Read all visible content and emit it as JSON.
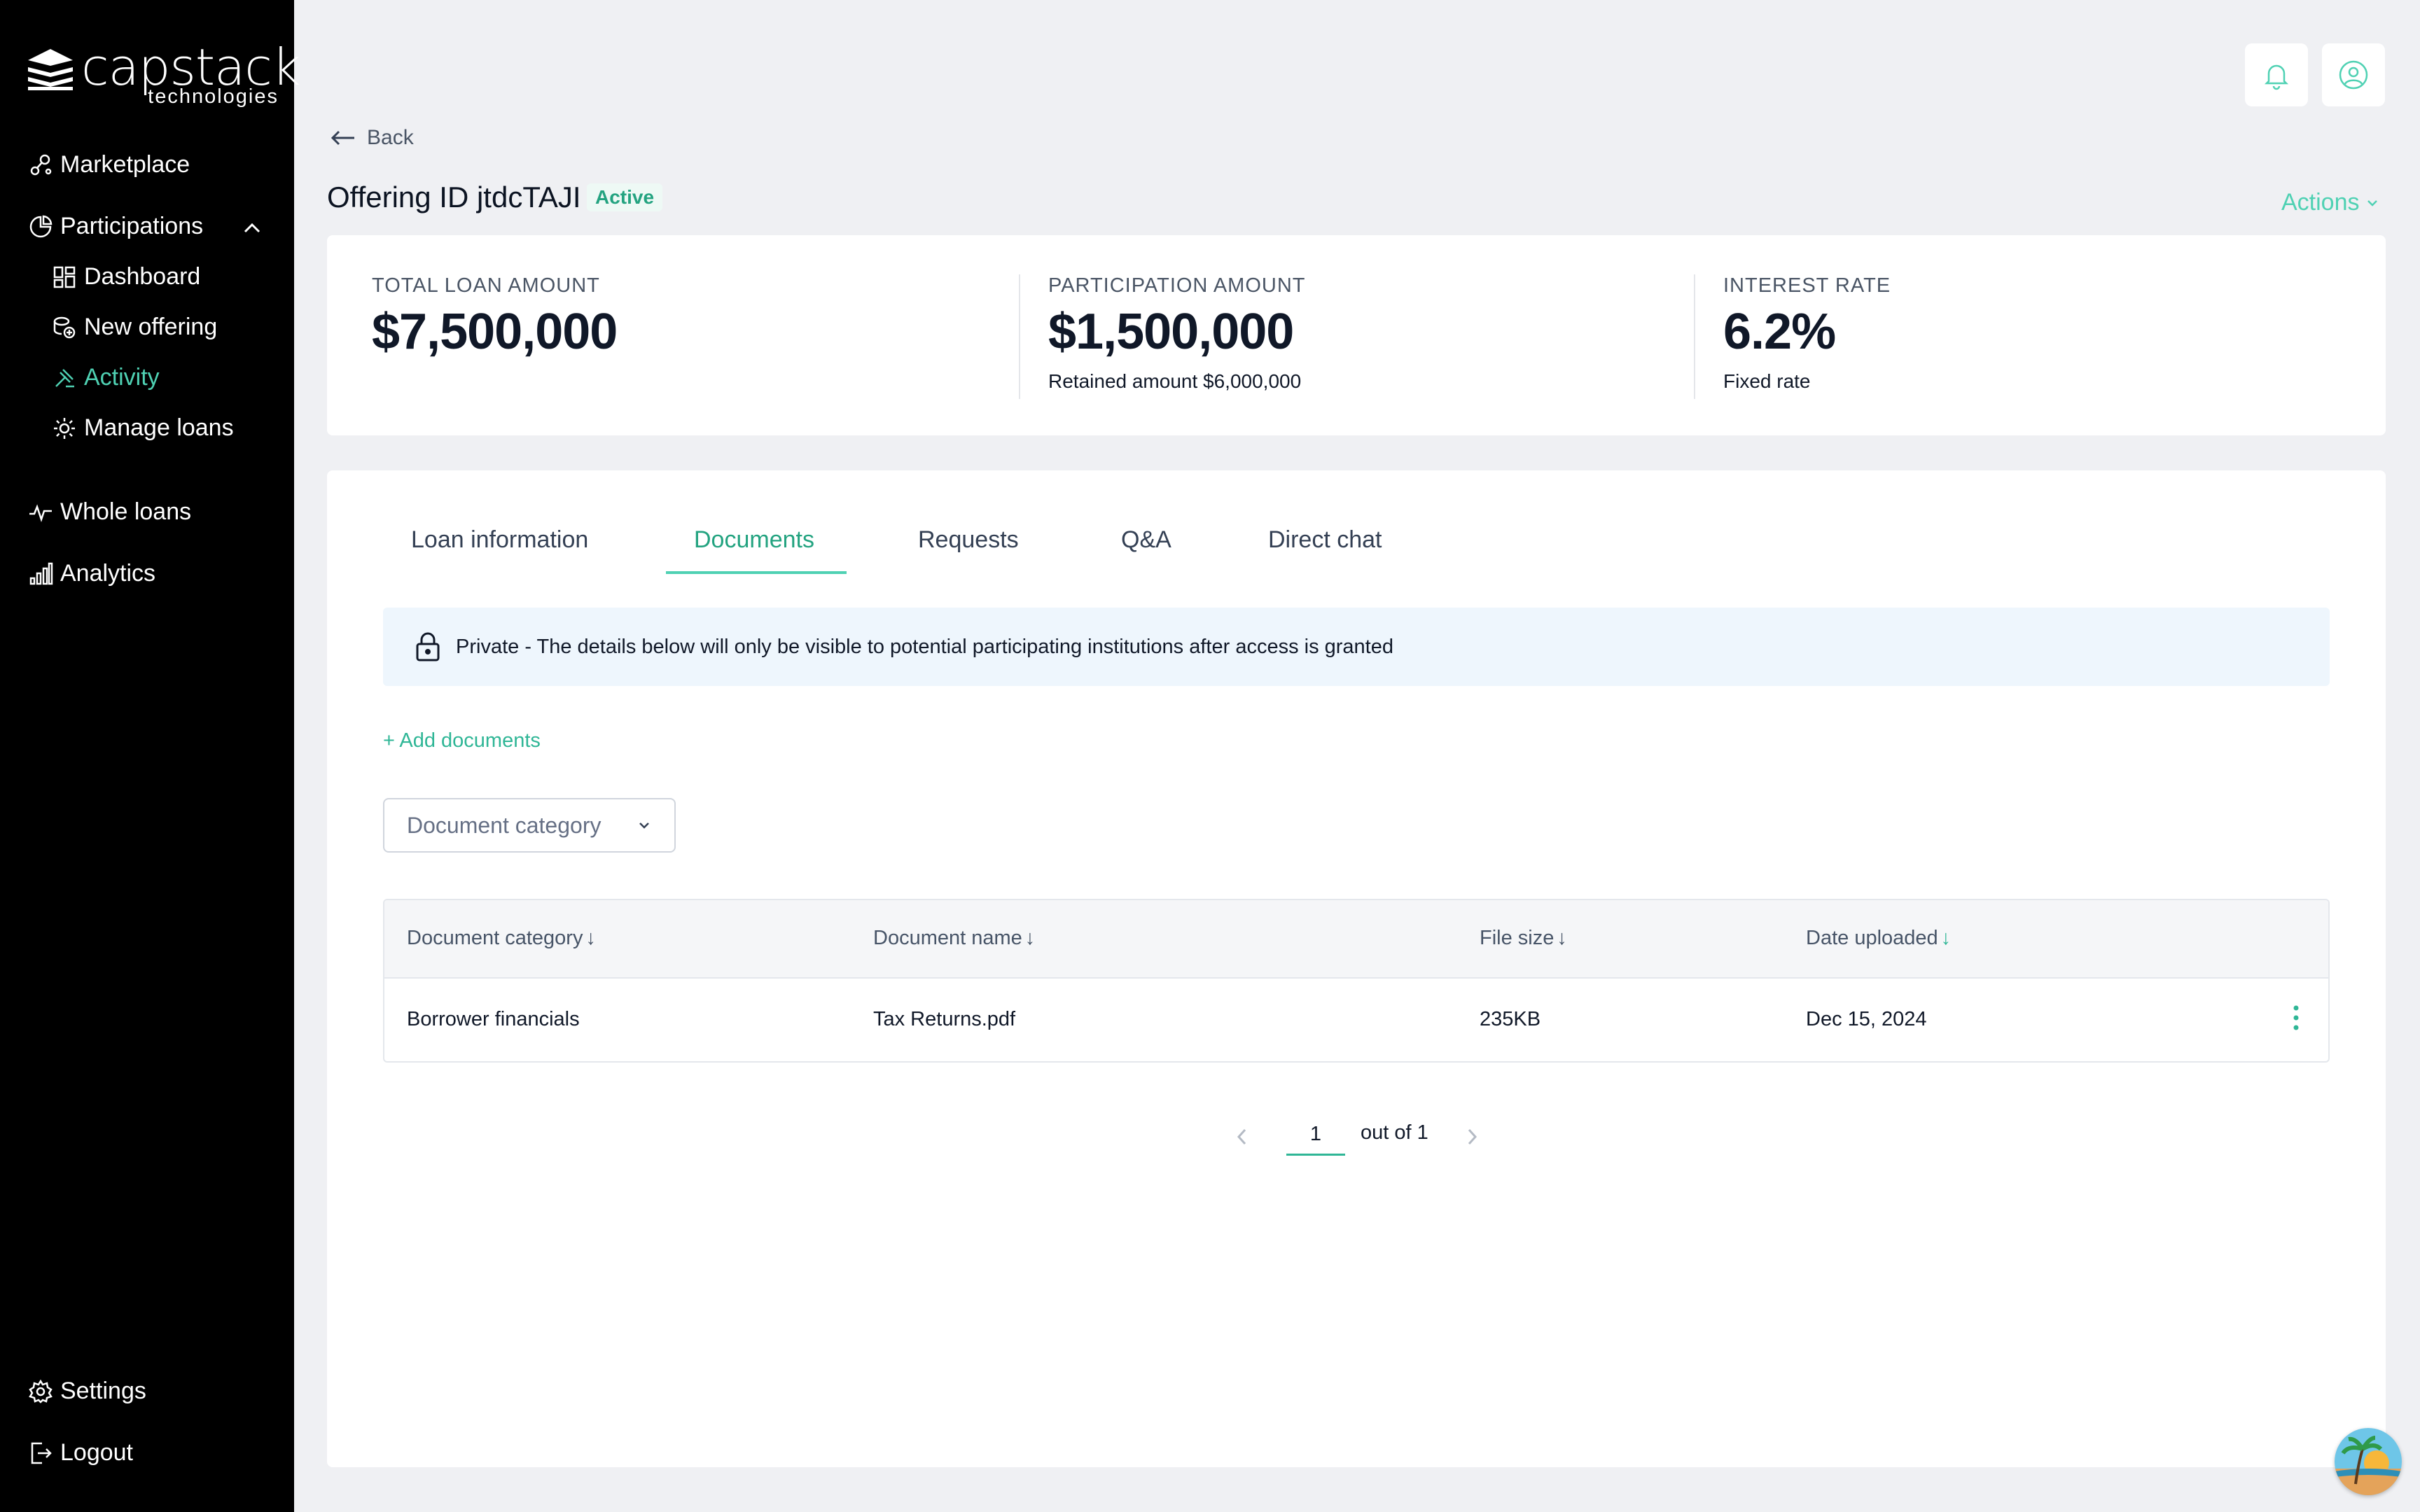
{
  "brand": {
    "name": "capstack",
    "sub": "technologies"
  },
  "sidebar": {
    "items": [
      {
        "label": "Marketplace",
        "icon": "marketplace-icon"
      },
      {
        "label": "Participations",
        "icon": "participations-icon"
      },
      {
        "label": "Dashboard",
        "icon": "dashboard-icon"
      },
      {
        "label": "New offering",
        "icon": "new-offering-icon"
      },
      {
        "label": "Activity",
        "icon": "activity-icon",
        "active": true
      },
      {
        "label": "Manage loans",
        "icon": "manage-loans-icon"
      },
      {
        "label": "Whole loans",
        "icon": "whole-loans-icon"
      },
      {
        "label": "Analytics",
        "icon": "analytics-icon"
      }
    ],
    "bottom": [
      {
        "label": "Settings",
        "icon": "gear-icon"
      },
      {
        "label": "Logout",
        "icon": "logout-icon"
      }
    ]
  },
  "header": {
    "back_label": "Back",
    "title": "Offering ID jtdcTAJI",
    "status": "Active",
    "actions_label": "Actions"
  },
  "stats": [
    {
      "label": "TOTAL LOAN AMOUNT",
      "value": "$7,500,000",
      "sub": ""
    },
    {
      "label": "PARTICIPATION AMOUNT",
      "value": "$1,500,000",
      "sub": "Retained amount $6,000,000"
    },
    {
      "label": "INTEREST RATE",
      "value": "6.2%",
      "sub": "Fixed rate"
    }
  ],
  "tabs": [
    {
      "label": "Loan information"
    },
    {
      "label": "Documents",
      "selected": true
    },
    {
      "label": "Requests"
    },
    {
      "label": "Q&A"
    },
    {
      "label": "Direct chat"
    }
  ],
  "notice": "Private - The details below will only be visible to potential participating institutions after access is granted",
  "add_documents_label": "+ Add documents",
  "filter": {
    "placeholder": "Document category"
  },
  "table": {
    "columns": [
      {
        "label": "Document category",
        "arrow": "↓"
      },
      {
        "label": "Document name",
        "arrow": "↓"
      },
      {
        "label": "File size",
        "arrow": "↓"
      },
      {
        "label": "Date uploaded",
        "arrow": "↓"
      }
    ],
    "rows": [
      {
        "category": "Borrower financials",
        "name": "Tax Returns.pdf",
        "size": "235KB",
        "date": "Dec 15, 2024"
      }
    ]
  },
  "pagination": {
    "page": "1",
    "total_label": "out of 1"
  },
  "colors": {
    "accent": "#4fd1b3",
    "sidebar_bg": "#000000",
    "page_bg": "#eff0f3"
  }
}
